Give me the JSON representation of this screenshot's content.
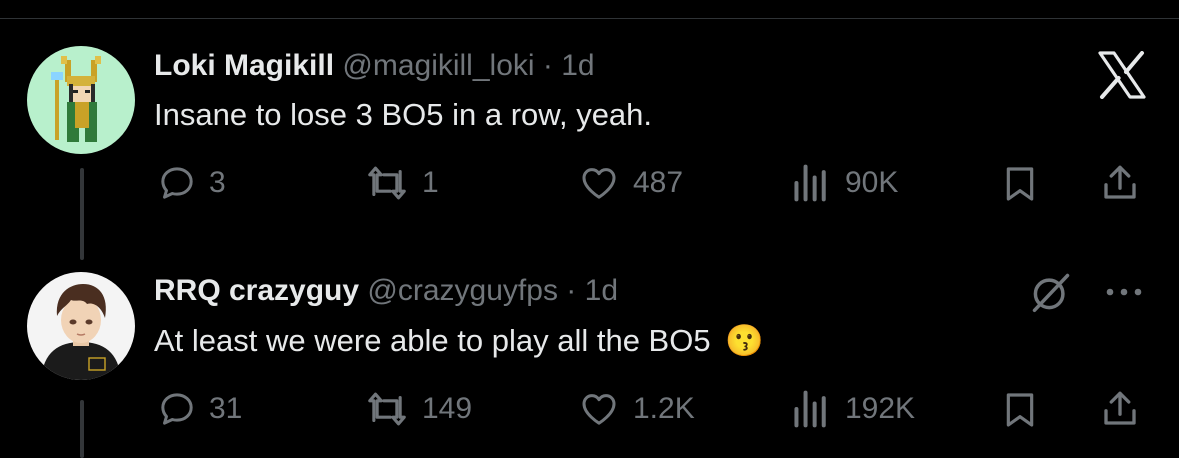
{
  "tweets": [
    {
      "display_name": "Loki Magikill",
      "handle": "@magikill_loki",
      "separator": "·",
      "age": "1d",
      "text": "Insane to lose 3 BO5 in a row, yeah.",
      "replies": "3",
      "reposts": "1",
      "likes": "487",
      "views": "90K",
      "avatar_icon": "pixel-art-character-avatar"
    },
    {
      "display_name": "RRQ crazyguy",
      "handle": "@crazyguyfps",
      "separator": "·",
      "age": "1d",
      "text": "At least we were able to play all the BO5",
      "emoji": "😗",
      "replies": "31",
      "reposts": "149",
      "likes": "1.2K",
      "views": "192K",
      "avatar_icon": "anime-character-avatar"
    }
  ],
  "icons": {
    "logo": "x-logo-icon",
    "reply": "reply-icon",
    "repost": "repost-icon",
    "like": "heart-icon",
    "views": "views-chart-icon",
    "bookmark": "bookmark-icon",
    "share": "share-icon",
    "grok": "grok-icon",
    "more": "more-dots-icon"
  },
  "colors": {
    "background": "#000000",
    "text": "#e7e9ea",
    "muted": "#71767b",
    "divider": "#2f3336"
  }
}
